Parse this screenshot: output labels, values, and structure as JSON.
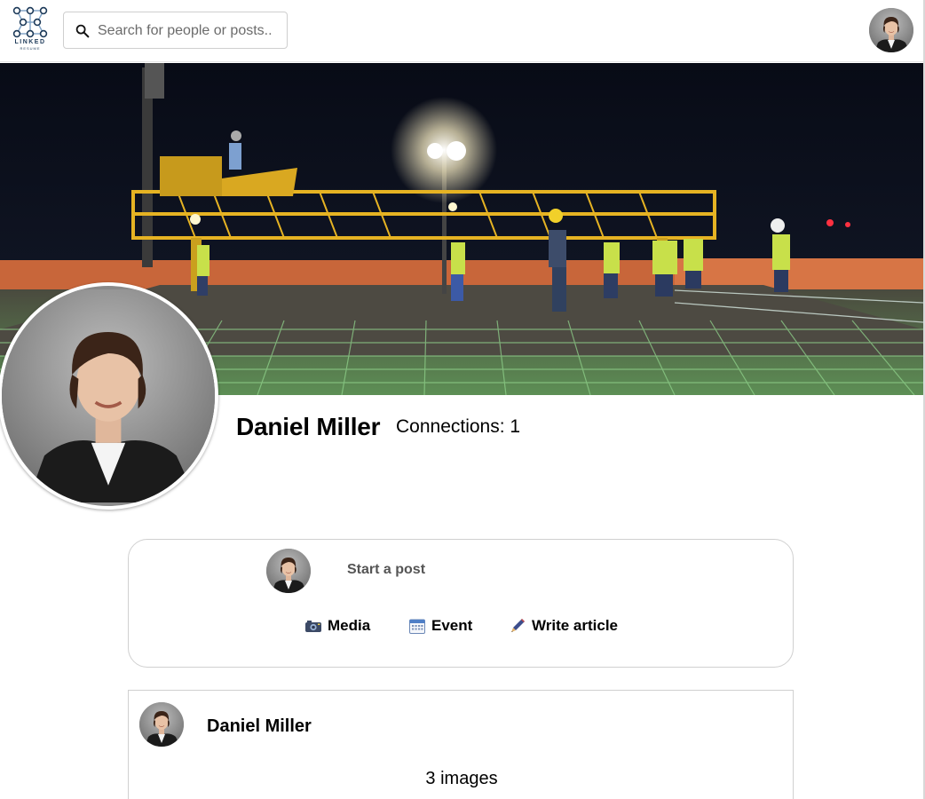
{
  "app": {
    "logo_name": "LINKED",
    "logo_sub": "RESUME",
    "colors": {
      "brand": "#1e3b5a",
      "border": "#d0d0d0",
      "muted_text": "#555555"
    }
  },
  "search": {
    "placeholder": "Search for people or posts..",
    "icon": "search-icon"
  },
  "nav": {
    "avatar_icon": "user-avatar"
  },
  "banner": {
    "image": "night-construction-site-photo"
  },
  "profile": {
    "name": "Daniel Miller",
    "connections_label": "Connections: 1"
  },
  "composer": {
    "start_label": "Start a post",
    "actions": [
      {
        "label": "Media",
        "icon": "camera-icon"
      },
      {
        "label": "Event",
        "icon": "calendar-icon"
      },
      {
        "label": "Write article",
        "icon": "pen-icon"
      }
    ]
  },
  "post": {
    "author": "Daniel Miller",
    "images_label": "3 images"
  }
}
